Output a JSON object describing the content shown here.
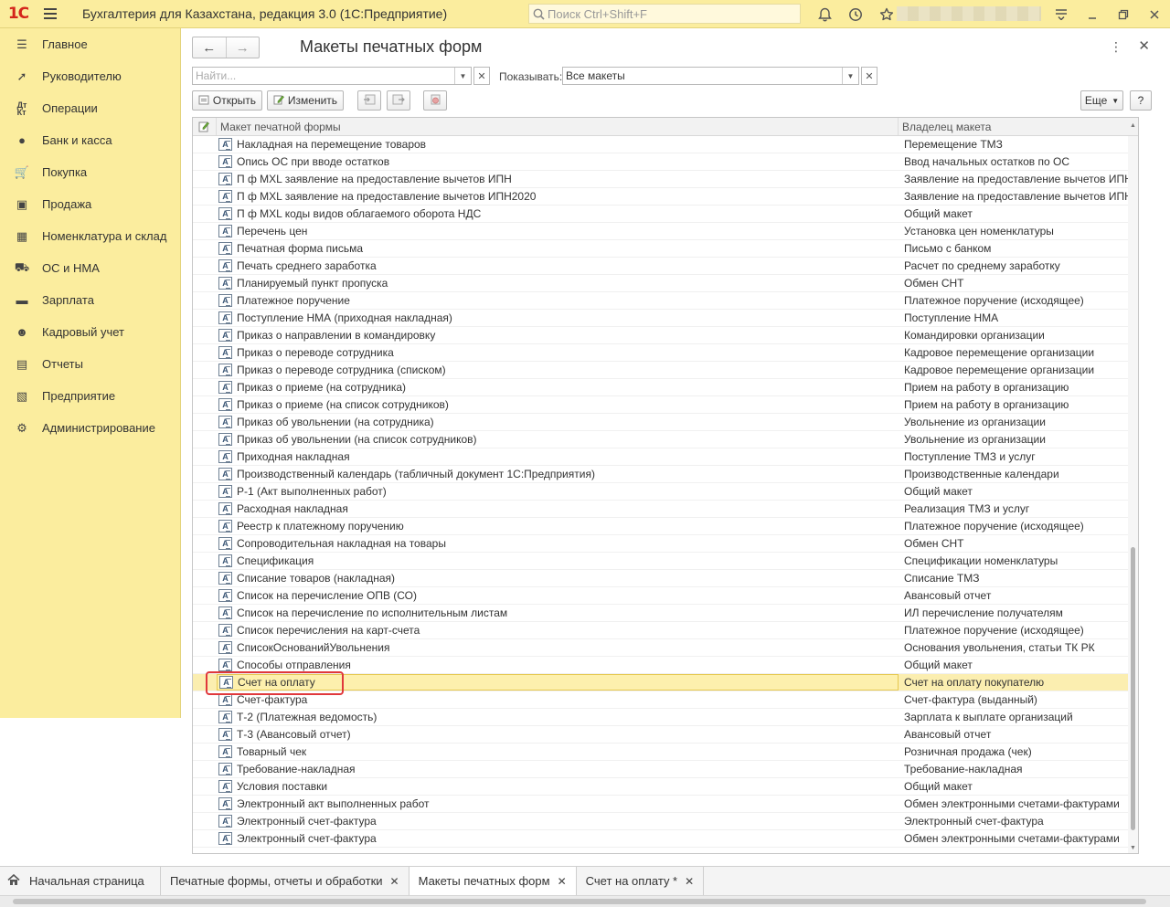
{
  "app": {
    "logo": "1С",
    "title": "Бухгалтерия для Казахстана, редакция 3.0  (1С:Предприятие)",
    "search_placeholder": "Поиск Ctrl+Shift+F"
  },
  "sidebar": {
    "items": [
      {
        "label": "Главное",
        "icon": "menu-lines-icon"
      },
      {
        "label": "Руководителю",
        "icon": "chart-line-icon"
      },
      {
        "label": "Операции",
        "icon": "dt-kt-icon"
      },
      {
        "label": "Банк и касса",
        "icon": "coin-icon"
      },
      {
        "label": "Покупка",
        "icon": "cart-icon"
      },
      {
        "label": "Продажа",
        "icon": "bag-icon"
      },
      {
        "label": "Номенклатура и склад",
        "icon": "grid-icon"
      },
      {
        "label": "ОС и НМА",
        "icon": "truck-icon"
      },
      {
        "label": "Зарплата",
        "icon": "wallet-icon"
      },
      {
        "label": "Кадровый учет",
        "icon": "people-icon"
      },
      {
        "label": "Отчеты",
        "icon": "bar-chart-icon"
      },
      {
        "label": "Предприятие",
        "icon": "building-icon"
      },
      {
        "label": "Администрирование",
        "icon": "gear-icon"
      }
    ]
  },
  "form": {
    "title": "Макеты печатных форм",
    "find_placeholder": "Найти...",
    "show_label": "Показывать:",
    "show_value": "Все макеты",
    "buttons": {
      "open": "Открыть",
      "edit": "Изменить",
      "more": "Еще",
      "help": "?"
    }
  },
  "table": {
    "columns": [
      "Макет печатной формы",
      "Владелец макета"
    ],
    "rows": [
      {
        "name": "Накладная на перемещение товаров",
        "owner": "Перемещение ТМЗ"
      },
      {
        "name": "Опись ОС при вводе остатков",
        "owner": "Ввод начальных остатков по ОС"
      },
      {
        "name": "П ф MXL заявление на предоставление вычетов ИПН",
        "owner": "Заявление на предоставление вычетов ИПН"
      },
      {
        "name": "П ф MXL заявление на предоставление вычетов ИПН2020",
        "owner": "Заявление на предоставление вычетов ИПН"
      },
      {
        "name": "П ф MXL коды видов облагаемого оборота НДС",
        "owner": "Общий макет"
      },
      {
        "name": "Перечень цен",
        "owner": "Установка цен номенклатуры"
      },
      {
        "name": "Печатная форма письма",
        "owner": "Письмо с банком"
      },
      {
        "name": "Печать среднего заработка",
        "owner": "Расчет по среднему заработку"
      },
      {
        "name": "Планируемый пункт пропуска",
        "owner": "Обмен СНТ"
      },
      {
        "name": "Платежное поручение",
        "owner": "Платежное поручение (исходящее)"
      },
      {
        "name": "Поступление НМА (приходная накладная)",
        "owner": "Поступление НМА"
      },
      {
        "name": "Приказ о направлении в командировку",
        "owner": "Командировки организации"
      },
      {
        "name": "Приказ о переводе сотрудника",
        "owner": "Кадровое перемещение организации"
      },
      {
        "name": "Приказ о переводе сотрудника (списком)",
        "owner": "Кадровое перемещение организации"
      },
      {
        "name": "Приказ о приеме (на сотрудника)",
        "owner": "Прием на работу в организацию"
      },
      {
        "name": "Приказ о приеме (на список сотрудников)",
        "owner": "Прием на работу в организацию"
      },
      {
        "name": "Приказ об увольнении (на сотрудника)",
        "owner": "Увольнение из организации"
      },
      {
        "name": "Приказ об увольнении (на список сотрудников)",
        "owner": "Увольнение из организации"
      },
      {
        "name": "Приходная накладная",
        "owner": "Поступление ТМЗ и услуг"
      },
      {
        "name": "Производственный календарь (табличный документ 1С:Предприятия)",
        "owner": "Производственные календари"
      },
      {
        "name": "Р-1 (Акт выполненных работ)",
        "owner": "Общий макет"
      },
      {
        "name": "Расходная накладная",
        "owner": "Реализация ТМЗ и услуг"
      },
      {
        "name": "Реестр к платежному поручению",
        "owner": "Платежное поручение (исходящее)"
      },
      {
        "name": "Сопроводительная накладная на товары",
        "owner": "Обмен СНТ"
      },
      {
        "name": "Спецификация",
        "owner": "Спецификации номенклатуры"
      },
      {
        "name": "Списание товаров (накладная)",
        "owner": "Списание ТМЗ"
      },
      {
        "name": "Список на перечисление ОПВ (СО)",
        "owner": "Авансовый отчет"
      },
      {
        "name": "Список на перечисление по исполнительным листам",
        "owner": "ИЛ перечисление получателям"
      },
      {
        "name": "Список перечисления на карт-счета",
        "owner": "Платежное поручение (исходящее)"
      },
      {
        "name": "СписокОснованийУвольнения",
        "owner": "Основания увольнения, статьи ТК РК"
      },
      {
        "name": "Способы отправления",
        "owner": "Общий макет"
      },
      {
        "name": "Счет на оплату",
        "owner": "Счет на оплату покупателю",
        "selected": true
      },
      {
        "name": "Счет-фактура",
        "owner": "Счет-фактура (выданный)"
      },
      {
        "name": "Т-2 (Платежная ведомость)",
        "owner": "Зарплата к выплате организаций"
      },
      {
        "name": "Т-3 (Авансовый отчет)",
        "owner": "Авансовый отчет"
      },
      {
        "name": "Товарный чек",
        "owner": "Розничная продажа (чек)"
      },
      {
        "name": "Требование-накладная",
        "owner": "Требование-накладная"
      },
      {
        "name": "Условия поставки",
        "owner": "Общий макет"
      },
      {
        "name": "Электронный акт выполненных работ",
        "owner": "Обмен электронными счетами-фактурами"
      },
      {
        "name": "Электронный счет-фактура",
        "owner": "Электронный счет-фактура"
      },
      {
        "name": "Электронный счет-фактура",
        "owner": "Обмен электронными счетами-фактурами"
      }
    ]
  },
  "tabs": [
    {
      "label": "Начальная страница",
      "home": true,
      "closable": false
    },
    {
      "label": "Печатные формы, отчеты и обработки",
      "closable": true
    },
    {
      "label": "Макеты печатных форм",
      "closable": true,
      "active": true
    },
    {
      "label": "Счет на оплату *",
      "closable": true
    }
  ],
  "colors": {
    "accent_yellow": "#fbed9e",
    "selection": "#fbeeb0",
    "highlight_red": "#e0383c",
    "logo_red": "#d4261c"
  }
}
